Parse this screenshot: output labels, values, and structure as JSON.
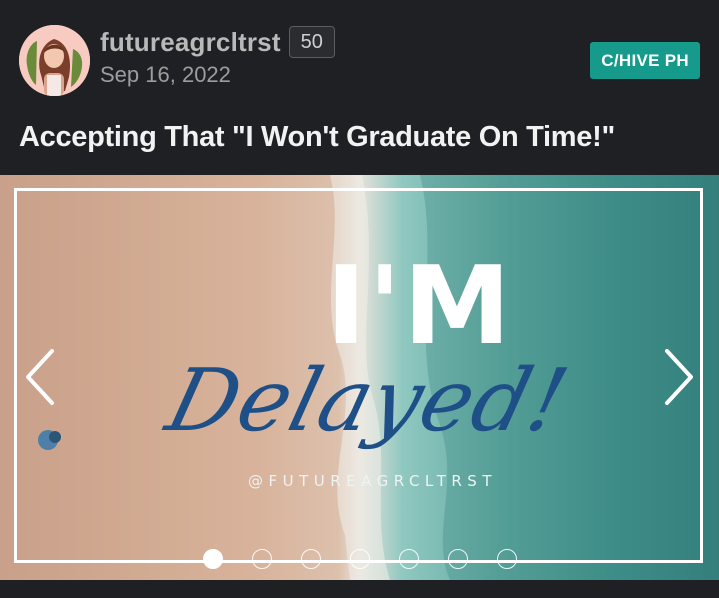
{
  "post": {
    "author": "futureagrcltrst",
    "reputation": "50",
    "date": "Sep 16, 2022",
    "community": "C/HIVE PH",
    "title": "Accepting That \"I Won't Graduate On Time!\""
  },
  "carousel": {
    "slide_text_big": "I'M",
    "slide_text_script": "Delayed!",
    "slide_handle": "@FUTUREAGRCLTRST",
    "slide_count": 7,
    "active_slide": 1,
    "prev_icon": "chevron-left-icon",
    "next_icon": "chevron-right-icon"
  },
  "colors": {
    "background": "#1f2023",
    "community_tag": "#159a8c",
    "script_text": "#1e4f86"
  }
}
